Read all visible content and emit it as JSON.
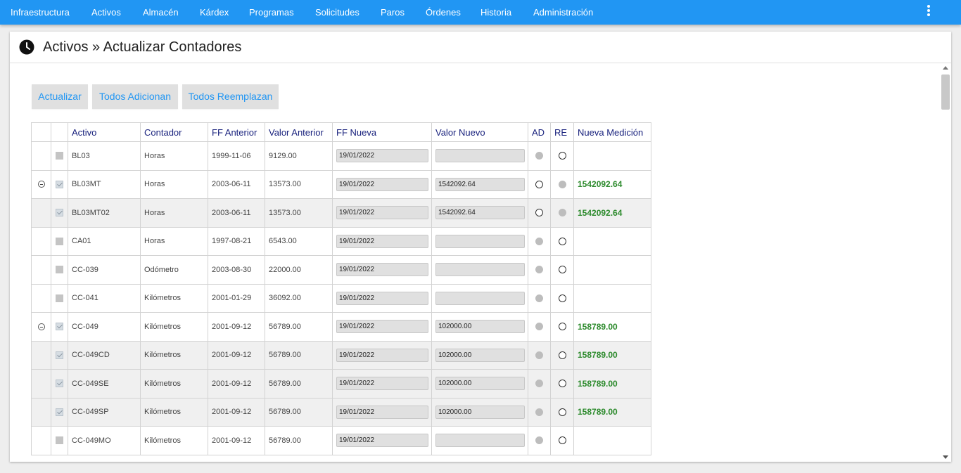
{
  "nav": {
    "items": [
      "Infraestructura",
      "Activos",
      "Almacén",
      "Kárdex",
      "Programas",
      "Solicitudes",
      "Paros",
      "Órdenes",
      "Historia",
      "Administración"
    ],
    "menu_icon": "more-vert-icon"
  },
  "page": {
    "title": "Activos » Actualizar Contadores",
    "title_icon": "clock-icon"
  },
  "toolbar": {
    "update_label": "Actualizar",
    "all_add_label": "Todos Adicionan",
    "all_replace_label": "Todos Reemplazan"
  },
  "table": {
    "headers": {
      "activo": "Activo",
      "contador": "Contador",
      "ff_anterior": "FF Anterior",
      "valor_anterior": "Valor Anterior",
      "ff_nueva": "FF Nueva",
      "valor_nuevo": "Valor Nuevo",
      "ad": "AD",
      "re": "RE",
      "nueva_medicion": "Nueva Medición"
    },
    "rows": [
      {
        "activo": "BL03",
        "contador": "Horas",
        "ff_anterior": "1999-11-06",
        "valor_anterior": "9129.00",
        "ff_nueva": "19/01/2022",
        "valor_nuevo": "",
        "nueva_medicion": "",
        "expander": false,
        "checked": false,
        "child": false,
        "ad": "gray",
        "re": "empty"
      },
      {
        "activo": "BL03MT",
        "contador": "Horas",
        "ff_anterior": "2003-06-11",
        "valor_anterior": "13573.00",
        "ff_nueva": "19/01/2022",
        "valor_nuevo": "1542092.64",
        "nueva_medicion": "1542092.64",
        "expander": true,
        "checked": true,
        "child": false,
        "ad": "empty",
        "re": "gray"
      },
      {
        "activo": "BL03MT02",
        "contador": "Horas",
        "ff_anterior": "2003-06-11",
        "valor_anterior": "13573.00",
        "ff_nueva": "19/01/2022",
        "valor_nuevo": "1542092.64",
        "nueva_medicion": "1542092.64",
        "expander": false,
        "checked": true,
        "child": true,
        "ad": "empty",
        "re": "gray"
      },
      {
        "activo": "CA01",
        "contador": "Horas",
        "ff_anterior": "1997-08-21",
        "valor_anterior": "6543.00",
        "ff_nueva": "19/01/2022",
        "valor_nuevo": "",
        "nueva_medicion": "",
        "expander": false,
        "checked": false,
        "child": false,
        "ad": "gray",
        "re": "empty"
      },
      {
        "activo": "CC-039",
        "contador": "Odómetro",
        "ff_anterior": "2003-08-30",
        "valor_anterior": "22000.00",
        "ff_nueva": "19/01/2022",
        "valor_nuevo": "",
        "nueva_medicion": "",
        "expander": false,
        "checked": false,
        "child": false,
        "ad": "gray",
        "re": "empty"
      },
      {
        "activo": "CC-041",
        "contador": "Kilómetros",
        "ff_anterior": "2001-01-29",
        "valor_anterior": "36092.00",
        "ff_nueva": "19/01/2022",
        "valor_nuevo": "",
        "nueva_medicion": "",
        "expander": false,
        "checked": false,
        "child": false,
        "ad": "gray",
        "re": "empty"
      },
      {
        "activo": "CC-049",
        "contador": "Kilómetros",
        "ff_anterior": "2001-09-12",
        "valor_anterior": "56789.00",
        "ff_nueva": "19/01/2022",
        "valor_nuevo": "102000.00",
        "nueva_medicion": "158789.00",
        "expander": true,
        "checked": true,
        "child": false,
        "ad": "gray",
        "re": "empty"
      },
      {
        "activo": "CC-049CD",
        "contador": "Kilómetros",
        "ff_anterior": "2001-09-12",
        "valor_anterior": "56789.00",
        "ff_nueva": "19/01/2022",
        "valor_nuevo": "102000.00",
        "nueva_medicion": "158789.00",
        "expander": false,
        "checked": true,
        "child": true,
        "ad": "gray",
        "re": "empty"
      },
      {
        "activo": "CC-049SE",
        "contador": "Kilómetros",
        "ff_anterior": "2001-09-12",
        "valor_anterior": "56789.00",
        "ff_nueva": "19/01/2022",
        "valor_nuevo": "102000.00",
        "nueva_medicion": "158789.00",
        "expander": false,
        "checked": true,
        "child": true,
        "ad": "gray",
        "re": "empty"
      },
      {
        "activo": "CC-049SP",
        "contador": "Kilómetros",
        "ff_anterior": "2001-09-12",
        "valor_anterior": "56789.00",
        "ff_nueva": "19/01/2022",
        "valor_nuevo": "102000.00",
        "nueva_medicion": "158789.00",
        "expander": false,
        "checked": true,
        "child": true,
        "ad": "gray",
        "re": "empty"
      },
      {
        "activo": "CC-049MO",
        "contador": "Kilómetros",
        "ff_anterior": "2001-09-12",
        "valor_anterior": "56789.00",
        "ff_nueva": "19/01/2022",
        "valor_nuevo": "",
        "nueva_medicion": "",
        "expander": false,
        "checked": false,
        "child": false,
        "ad": "gray",
        "re": "empty"
      }
    ]
  },
  "colors": {
    "topbar": "#2196f3",
    "header_text": "#1a237e",
    "medicion_text": "#2e8b2e",
    "button_bg": "#e0e0e0"
  }
}
